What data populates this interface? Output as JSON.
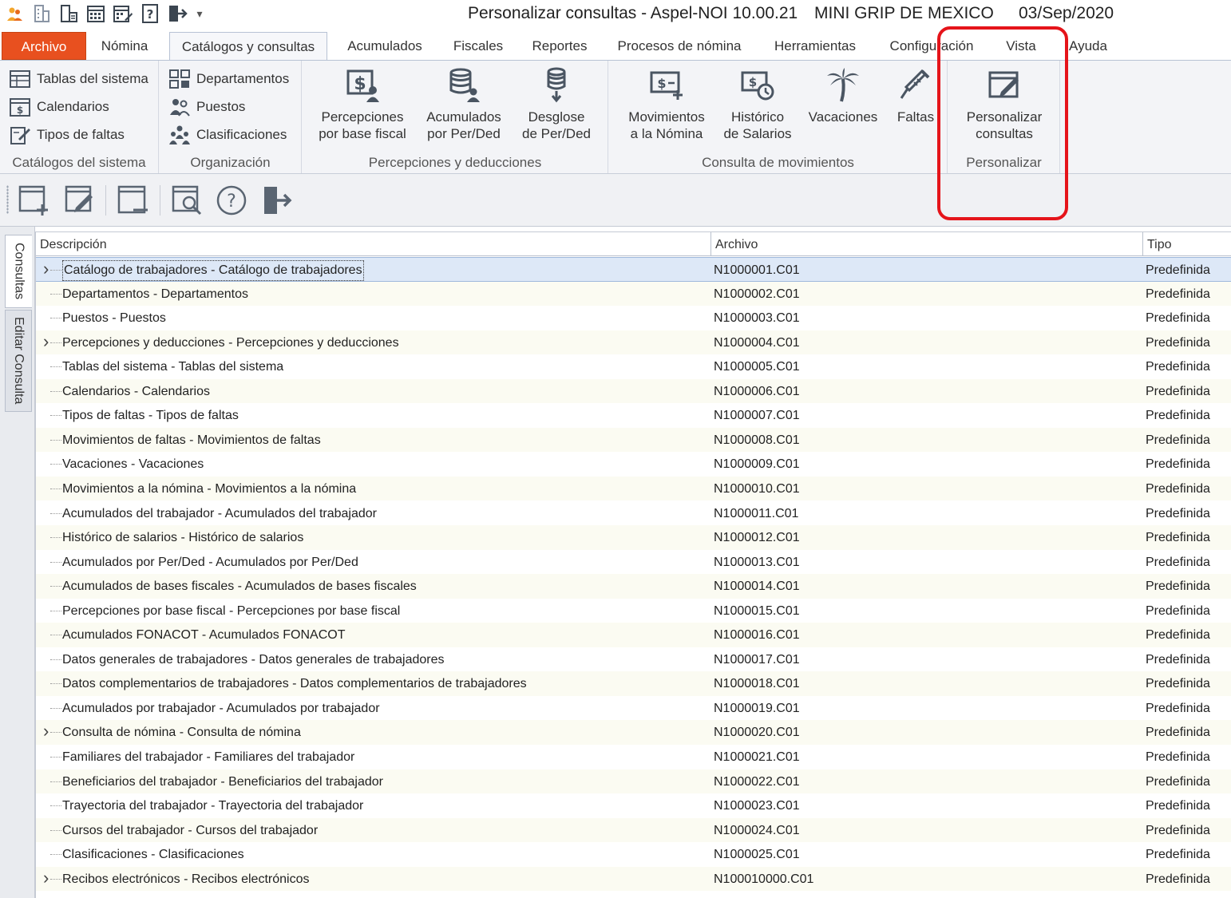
{
  "titlebar": {
    "title": "Personalizar consultas - Aspel-NOI 10.00.21",
    "company": "MINI GRIP DE MEXICO",
    "date": "03/Sep/2020",
    "qat_icons": [
      "app-icon",
      "building-icon",
      "building-list-icon",
      "calendar-grid-icon",
      "calendar-edit-icon",
      "help-document-icon",
      "exit-icon"
    ],
    "qat_dropdown": "▾"
  },
  "tabs": {
    "archivo": "Archivo",
    "nomina": "Nómina",
    "catalogos": "Catálogos y consultas",
    "acumulados": "Acumulados",
    "fiscales": "Fiscales",
    "reportes": "Reportes",
    "procesos": "Procesos de nómina",
    "herramientas": "Herramientas",
    "configuracion": "Configuración",
    "vista": "Vista",
    "ayuda": "Ayuda"
  },
  "ribbon": {
    "catalogos_sistema": {
      "label": "Catálogos del sistema",
      "tablas": "Tablas del sistema",
      "calendarios": "Calendarios",
      "tipos_faltas": "Tipos de faltas"
    },
    "organizacion": {
      "label": "Organización",
      "departamentos": "Departamentos",
      "puestos": "Puestos",
      "clasificaciones": "Clasificaciones"
    },
    "percepciones": {
      "label": "Percepciones y deducciones",
      "base_fiscal_1": "Percepciones",
      "base_fiscal_2": "por base fiscal",
      "acumulados_1": "Acumulados",
      "acumulados_2": "por Per/Ded",
      "desglose_1": "Desglose",
      "desglose_2": "de Per/Ded"
    },
    "movimientos": {
      "label": "Consulta de movimientos",
      "mov_1": "Movimientos",
      "mov_2": "a la Nómina",
      "hist_1": "Histórico",
      "hist_2": "de Salarios",
      "vacaciones": "Vacaciones",
      "faltas": "Faltas"
    },
    "personalizar": {
      "label": "Personalizar",
      "btn_1": "Personalizar",
      "btn_2": "consultas"
    }
  },
  "toolbar": {
    "buttons": [
      "add-query-icon",
      "edit-query-icon",
      "remove-query-icon",
      "preview-icon",
      "help-icon",
      "exit-icon"
    ]
  },
  "sidebar": {
    "consultas": "Consultas",
    "editar": "Editar Consulta"
  },
  "grid": {
    "headers": {
      "descripcion": "Descripción",
      "archivo": "Archivo",
      "tipo": "Tipo"
    },
    "rows": [
      {
        "desc": "Catálogo de trabajadores - Catálogo de trabajadores",
        "archivo": "N1000001.C01",
        "tipo": "Predefinida",
        "expandable": true
      },
      {
        "desc": "Departamentos - Departamentos",
        "archivo": "N1000002.C01",
        "tipo": "Predefinida",
        "expandable": false
      },
      {
        "desc": "Puestos - Puestos",
        "archivo": "N1000003.C01",
        "tipo": "Predefinida",
        "expandable": false
      },
      {
        "desc": "Percepciones y deducciones - Percepciones y deducciones",
        "archivo": "N1000004.C01",
        "tipo": "Predefinida",
        "expandable": true
      },
      {
        "desc": "Tablas del sistema - Tablas del sistema",
        "archivo": "N1000005.C01",
        "tipo": "Predefinida",
        "expandable": false
      },
      {
        "desc": "Calendarios - Calendarios",
        "archivo": "N1000006.C01",
        "tipo": "Predefinida",
        "expandable": false
      },
      {
        "desc": "Tipos de faltas - Tipos de faltas",
        "archivo": "N1000007.C01",
        "tipo": "Predefinida",
        "expandable": false
      },
      {
        "desc": "Movimientos de faltas - Movimientos de faltas",
        "archivo": "N1000008.C01",
        "tipo": "Predefinida",
        "expandable": false
      },
      {
        "desc": "Vacaciones - Vacaciones",
        "archivo": "N1000009.C01",
        "tipo": "Predefinida",
        "expandable": false
      },
      {
        "desc": "Movimientos a la nómina - Movimientos a la nómina",
        "archivo": "N1000010.C01",
        "tipo": "Predefinida",
        "expandable": false
      },
      {
        "desc": "Acumulados del trabajador - Acumulados del trabajador",
        "archivo": "N1000011.C01",
        "tipo": "Predefinida",
        "expandable": false
      },
      {
        "desc": "Histórico de salarios - Histórico de salarios",
        "archivo": "N1000012.C01",
        "tipo": "Predefinida",
        "expandable": false
      },
      {
        "desc": "Acumulados por Per/Ded - Acumulados por Per/Ded",
        "archivo": "N1000013.C01",
        "tipo": "Predefinida",
        "expandable": false
      },
      {
        "desc": "Acumulados de bases fiscales - Acumulados de bases fiscales",
        "archivo": "N1000014.C01",
        "tipo": "Predefinida",
        "expandable": false
      },
      {
        "desc": "Percepciones por base fiscal - Percepciones por base fiscal",
        "archivo": "N1000015.C01",
        "tipo": "Predefinida",
        "expandable": false
      },
      {
        "desc": "Acumulados FONACOT - Acumulados FONACOT",
        "archivo": "N1000016.C01",
        "tipo": "Predefinida",
        "expandable": false
      },
      {
        "desc": "Datos generales de trabajadores - Datos generales de trabajadores",
        "archivo": "N1000017.C01",
        "tipo": "Predefinida",
        "expandable": false
      },
      {
        "desc": "Datos complementarios de trabajadores - Datos complementarios de trabajadores",
        "archivo": "N1000018.C01",
        "tipo": "Predefinida",
        "expandable": false
      },
      {
        "desc": "Acumulados por trabajador - Acumulados por trabajador",
        "archivo": "N1000019.C01",
        "tipo": "Predefinida",
        "expandable": false
      },
      {
        "desc": "Consulta de nómina - Consulta de nómina",
        "archivo": "N1000020.C01",
        "tipo": "Predefinida",
        "expandable": true
      },
      {
        "desc": "Familiares del trabajador - Familiares del trabajador",
        "archivo": "N1000021.C01",
        "tipo": "Predefinida",
        "expandable": false
      },
      {
        "desc": "Beneficiarios del trabajador - Beneficiarios del trabajador",
        "archivo": "N1000022.C01",
        "tipo": "Predefinida",
        "expandable": false
      },
      {
        "desc": "Trayectoria del trabajador - Trayectoria del trabajador",
        "archivo": "N1000023.C01",
        "tipo": "Predefinida",
        "expandable": false
      },
      {
        "desc": "Cursos del trabajador - Cursos del trabajador",
        "archivo": "N1000024.C01",
        "tipo": "Predefinida",
        "expandable": false
      },
      {
        "desc": "Clasificaciones - Clasificaciones",
        "archivo": "N1000025.C01",
        "tipo": "Predefinida",
        "expandable": false
      },
      {
        "desc": "Recibos electrónicos - Recibos electrónicos",
        "archivo": "N100010000.C01",
        "tipo": "Predefinida",
        "expandable": true
      }
    ]
  },
  "colors": {
    "file_tab": "#e8501f",
    "highlight": "#e5141a",
    "selected_row": "#dde8f7",
    "alt_row": "#fbfbf2"
  }
}
